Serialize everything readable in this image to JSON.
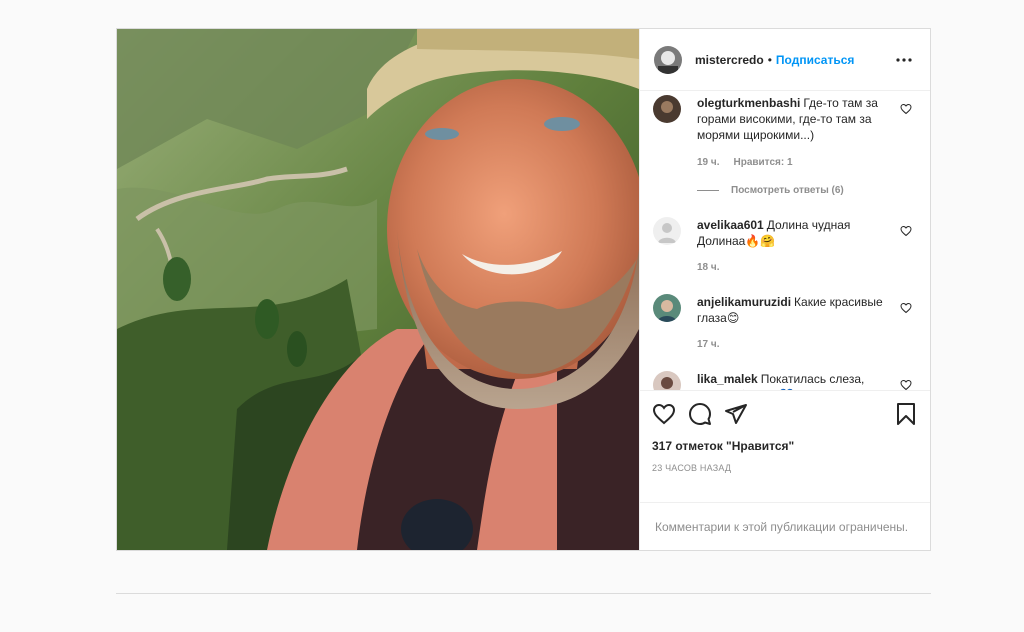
{
  "header": {
    "username": "mistercredo",
    "dot": "•",
    "follow_label": "Подписаться",
    "more_icon": "more-horizontal-icon"
  },
  "comments": [
    {
      "user": "olegturkmenbashi",
      "text": "Где-то там за горами високими, где-то там за морями щирокими...)",
      "time": "19 ч.",
      "likes": "Нравится: 1",
      "replies": "Посмотреть ответы (6)"
    },
    {
      "user": "avelikaa601",
      "text": "Долина чудная Долинаа🔥🤗",
      "time": "18 ч."
    },
    {
      "user": "anjelikamuruzidi",
      "text": "Какие красивые глаза😊",
      "time": "17 ч."
    },
    {
      "user": "lika_malek",
      "text": "Покатилась слеза, чистая бирюза💙 зацепили меня голубые глаза)",
      "time": ""
    }
  ],
  "actions": {
    "likes": "317 отметок \"Нравится\"",
    "time": "23 ЧАСОВ НАЗАД"
  },
  "limited_text": "Комментарии к этой публикации ограничены.",
  "colors": {
    "link": "#0095f6",
    "muted": "#8e8e8e",
    "border": "#dbdbdb"
  }
}
